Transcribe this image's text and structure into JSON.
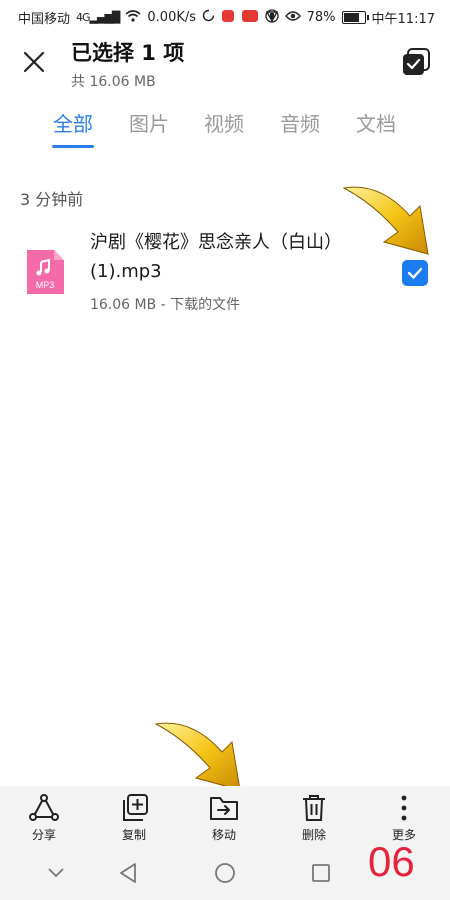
{
  "status_bar": {
    "carrier": "中国移动",
    "network_speed": "0.00K/s",
    "battery": "78%",
    "time": "中午11:17"
  },
  "header": {
    "title": "已选择 1 项",
    "subtitle": "共 16.06 MB"
  },
  "tabs": [
    {
      "label": "全部",
      "active": true
    },
    {
      "label": "图片",
      "active": false
    },
    {
      "label": "视频",
      "active": false
    },
    {
      "label": "音频",
      "active": false
    },
    {
      "label": "文档",
      "active": false
    }
  ],
  "group": {
    "header": "3 分钟前"
  },
  "files": [
    {
      "name": "沪剧《樱花》思念亲人（白山）(1).mp3",
      "meta": "16.06 MB - 下载的文件",
      "icon_label": "MP3",
      "checked": true
    }
  ],
  "actions": [
    {
      "label": "分享",
      "icon": "share-icon"
    },
    {
      "label": "复制",
      "icon": "copy-icon"
    },
    {
      "label": "移动",
      "icon": "move-icon"
    },
    {
      "label": "删除",
      "icon": "delete-icon"
    },
    {
      "label": "更多",
      "icon": "more-icon"
    }
  ],
  "stamp": "06",
  "colors": {
    "accent": "#2b7de9",
    "checkbox": "#1a7cf0",
    "mp3_icon": "#f56aa8",
    "stamp": "#e8223d"
  }
}
